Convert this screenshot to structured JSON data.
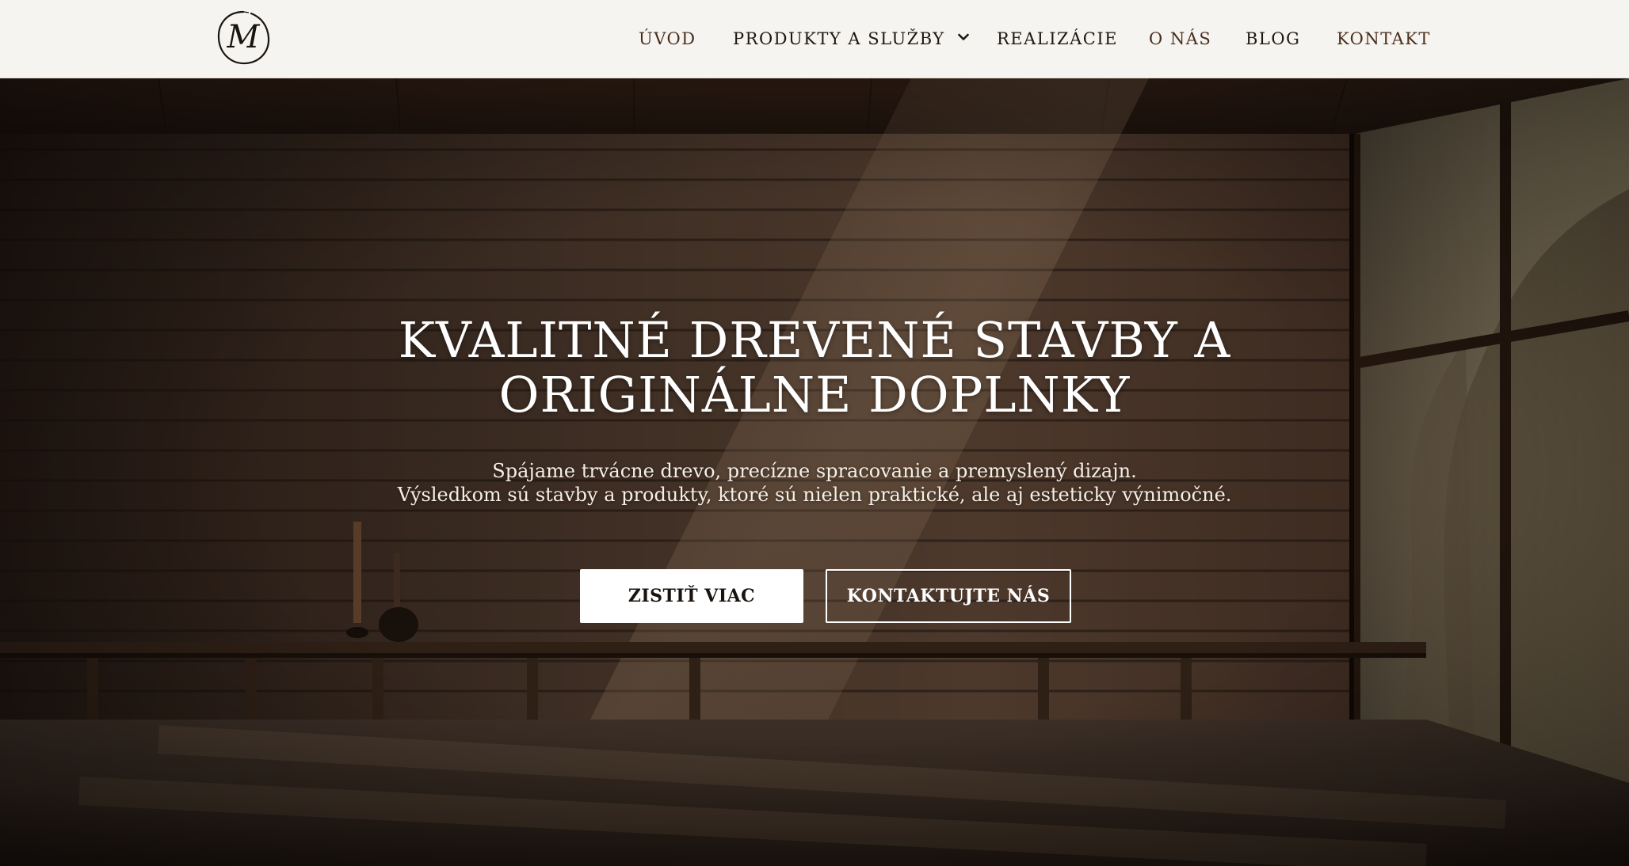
{
  "logo": {
    "letter": "M",
    "icon": "monogram-logo"
  },
  "nav": {
    "items": [
      {
        "label": "ÚVOD"
      },
      {
        "label": "PRODUKTY A SLUŽBY",
        "has_dropdown": true
      },
      {
        "label": "REALIZÁCIE"
      },
      {
        "label": "O NÁS"
      },
      {
        "label": "BLOG"
      },
      {
        "label": "KONTAKT"
      }
    ]
  },
  "hero": {
    "title_lines": [
      "KVALITNÉ DREVENÉ STAVBY A",
      "ORIGINÁLNE DOPLNKY"
    ],
    "subtitle_lines": [
      "Spájame trvácne drevo, precízne spracovanie a premyslený dizajn.",
      "Výsledkom sú stavby a produkty, ktoré sú nielen praktické, ale aj esteticky výnimočné."
    ],
    "primary_button": "ZISTIŤ VIAC",
    "secondary_button": "KONTAKTUJTE NÁS"
  },
  "colors": {
    "header_bg": "#f6f4f0",
    "nav_text": "#1d1712",
    "nav_accent": "#4a2e1e",
    "hero_text": "#ffffff"
  }
}
